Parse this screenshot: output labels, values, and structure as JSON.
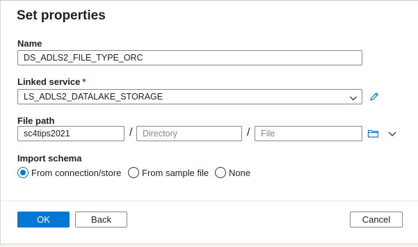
{
  "dialog": {
    "title": "Set properties"
  },
  "name_field": {
    "label": "Name",
    "value": "DS_ADLS2_FILE_TYPE_ORC"
  },
  "linked_service": {
    "label": "Linked service",
    "required_marker": "*",
    "value": "LS_ADLS2_DATALAKE_STORAGE",
    "edit_icon": "pencil-icon",
    "dropdown_icon": "chevron-down-icon"
  },
  "file_path": {
    "label": "File path",
    "container_value": "sc4tips2021",
    "separator": "/",
    "directory_placeholder": "Directory",
    "file_placeholder": "File",
    "browse_icon": "folder-icon",
    "expand_icon": "chevron-down-icon"
  },
  "import_schema": {
    "label": "Import schema",
    "options": [
      {
        "label": "From connection/store",
        "selected": true
      },
      {
        "label": "From sample file",
        "selected": false
      },
      {
        "label": "None",
        "selected": false
      }
    ]
  },
  "footer": {
    "ok_label": "OK",
    "back_label": "Back",
    "cancel_label": "Cancel"
  },
  "colors": {
    "primary": "#0078d4",
    "required": "#a4262c",
    "border": "#8a8886"
  }
}
